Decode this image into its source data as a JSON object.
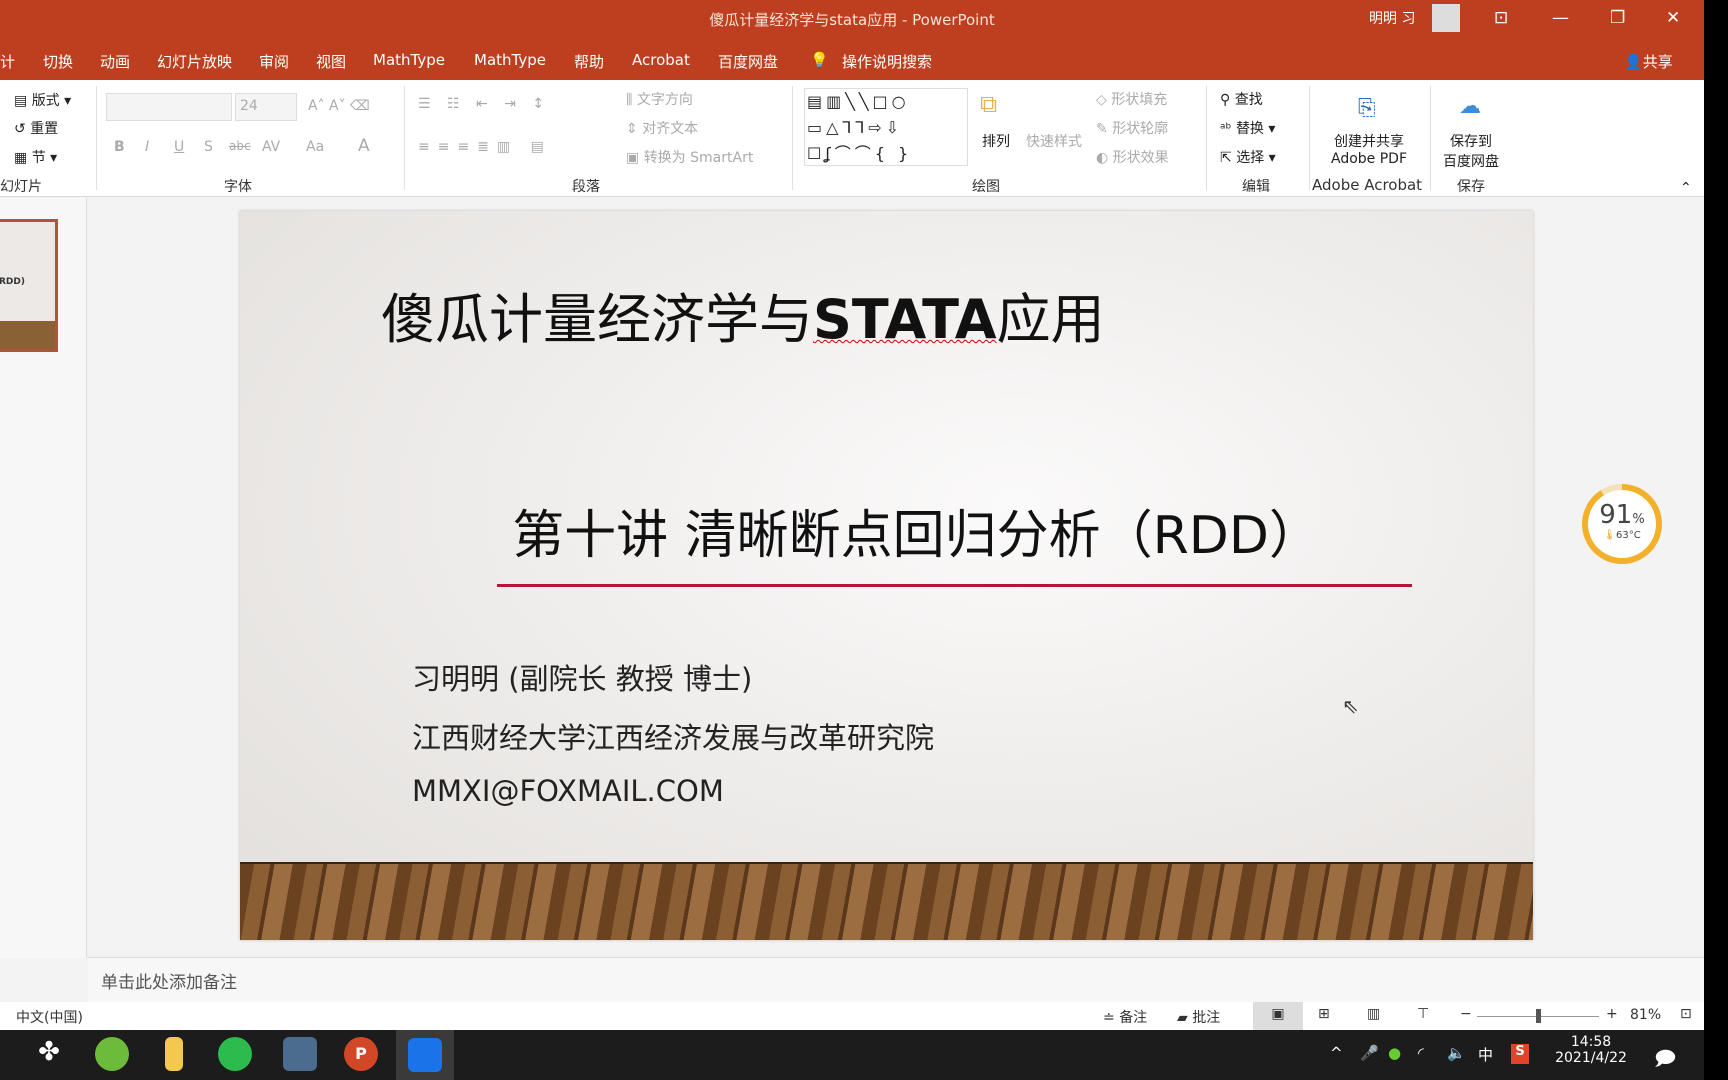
{
  "window": {
    "title": "傻瓜计量经济学与stata应用  -  PowerPoint",
    "user": "明明 习",
    "share": "共享"
  },
  "tabs": [
    "计",
    "切换",
    "动画",
    "幻灯片放映",
    "审阅",
    "视图",
    "MathType",
    "MathType",
    "帮助",
    "Acrobat",
    "百度网盘",
    "操作说明搜索"
  ],
  "ribbon": {
    "slides": {
      "layout": "版式",
      "reset": "重置",
      "section": "节",
      "label": "幻灯片"
    },
    "font": {
      "size": "24",
      "label": "字体",
      "bold": "B",
      "italic": "I",
      "underline": "U",
      "shadow": "S",
      "strike": "abc",
      "spacing": "AV",
      "case": "Aa",
      "color": "A"
    },
    "paragraph": {
      "text_dir": "文字方向",
      "align_text": "对齐文本",
      "smartart": "转换为 SmartArt",
      "label": "段落"
    },
    "drawing": {
      "arrange": "排列",
      "quick_styles": "快速样式",
      "fill": "形状填充",
      "outline": "形状轮廓",
      "effects": "形状效果",
      "label": "绘图"
    },
    "editing": {
      "find": "查找",
      "replace": "替换",
      "select": "选择",
      "label": "编辑"
    },
    "acrobat": {
      "create": "创建并共享",
      "pdf": "Adobe PDF",
      "label": "Adobe Acrobat"
    },
    "save": {
      "line1": "保存到",
      "line2": "百度网盘",
      "label": "保存"
    }
  },
  "thumbnail": {
    "text": "RDD)"
  },
  "slide": {
    "title_cn": "傻瓜计量经济学与",
    "title_en": "STATA",
    "title_end": "应用",
    "subtitle": "第十讲 清晰断点回归分析（RDD）",
    "author": "习明明 (副院长 教授 博士)",
    "institution": "江西财经大学江西经济发展与改革研究院",
    "email": "MMXI@FOXMAIL.COM",
    "accent": "#b0173a"
  },
  "notes": {
    "placeholder": "单击此处添加备注"
  },
  "status": {
    "language": "中文(中国)",
    "notes": "备注",
    "comments": "批注",
    "zoom": "81%",
    "zoom_fraction": 0.5
  },
  "widget": {
    "percent": "91",
    "unit": "%",
    "temp": "63°C",
    "level": 0.91
  },
  "taskbar": {
    "time": "14:58",
    "date": "2021/4/22",
    "ime": "中"
  }
}
